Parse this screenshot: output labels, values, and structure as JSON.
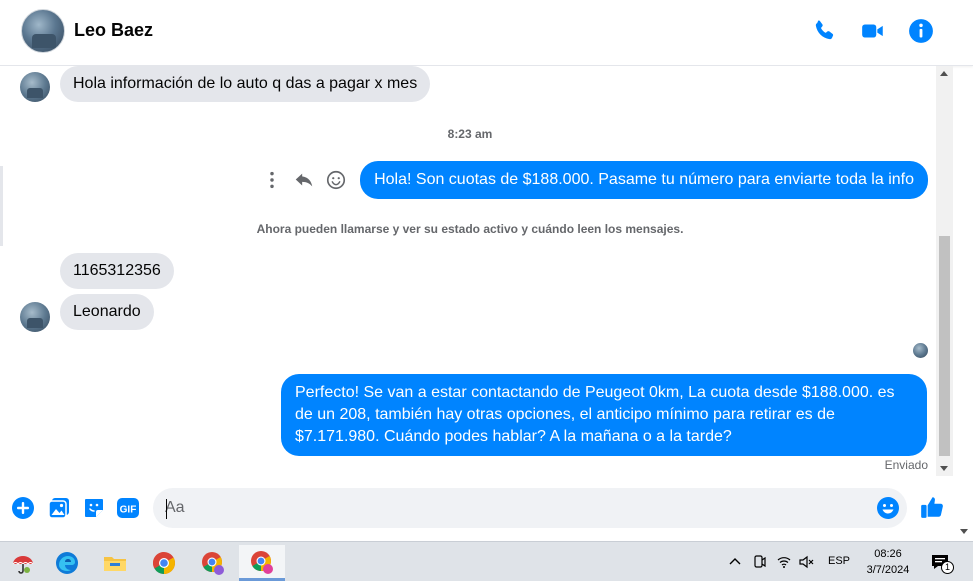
{
  "header": {
    "contact_name": "Leo Baez"
  },
  "chat": {
    "messages": [
      {
        "text": "Hola información de lo auto q das a pagar x mes"
      },
      {
        "text": "Hola! Son cuotas de $188.000. Pasame tu número para enviarte toda la info"
      },
      {
        "text": "1165312356"
      },
      {
        "text": "Leonardo"
      },
      {
        "text": "Perfecto!  Se van a estar contactando de Peugeot 0km, La cuota desde $188.000. es de un 208, también hay otras opciones, el anticipo mínimo para retirar es de $7.171.980. Cuándo podes hablar? A la mañana o a la tarde?"
      }
    ],
    "timestamp": "8:23 am",
    "notice": "Ahora pueden llamarse y ver su estado activo y cuándo leen los mensajes.",
    "status": "Enviado"
  },
  "composer": {
    "placeholder": "Aa",
    "gif_label": "GIF"
  },
  "taskbar": {
    "language": "ESP",
    "time": "08:26",
    "date": "3/7/2024",
    "notification_count": "1"
  },
  "colors": {
    "accent": "#0084ff",
    "incoming_bubble": "#e4e6eb"
  }
}
